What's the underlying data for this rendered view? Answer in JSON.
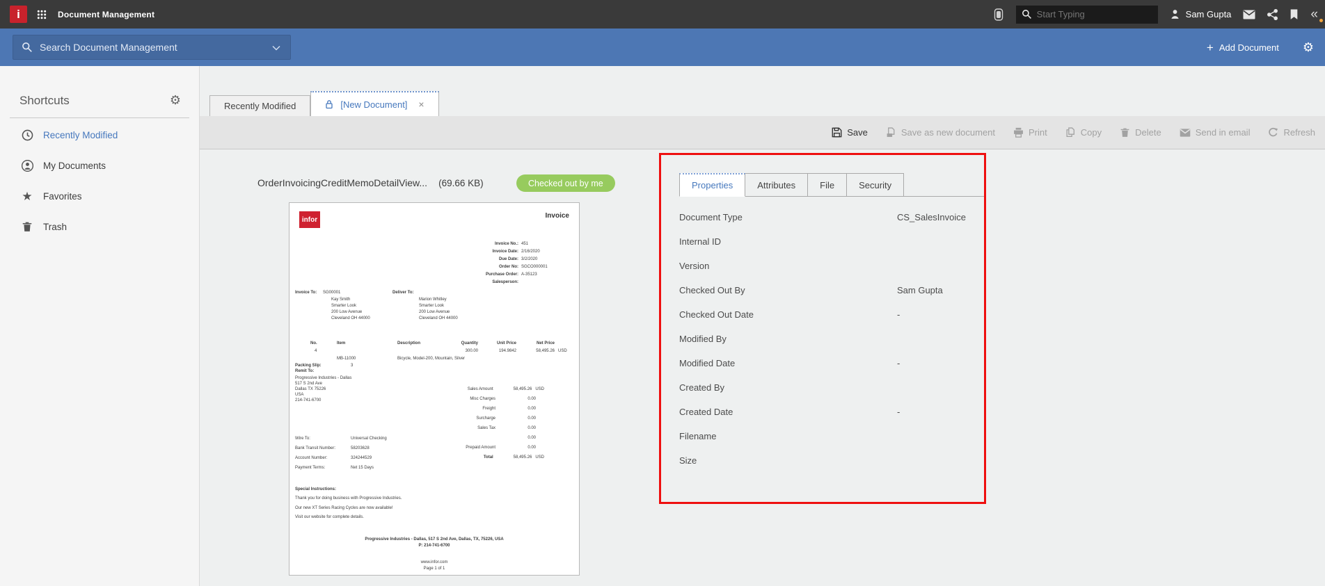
{
  "icons": {
    "gear": "⚙",
    "star": "★",
    "plus": "+",
    "collapse": "«",
    "close": "×"
  },
  "topbar": {
    "app_title": "Document Management",
    "search_placeholder": "Start Typing",
    "user_name": "Sam Gupta"
  },
  "bluebar": {
    "search_label": "Search Document Management",
    "add_document_label": "Add Document"
  },
  "sidebar": {
    "title": "Shortcuts",
    "items": [
      {
        "label": "Recently Modified"
      },
      {
        "label": "My Documents"
      },
      {
        "label": "Favorites"
      },
      {
        "label": "Trash"
      }
    ]
  },
  "tabs": {
    "recently_modified": "Recently Modified",
    "new_document": "[New Document]"
  },
  "toolbar": {
    "save": "Save",
    "save_as_new": "Save as new document",
    "print": "Print",
    "copy": "Copy",
    "delete": "Delete",
    "send_in_email": "Send in email",
    "refresh": "Refresh"
  },
  "document": {
    "name": "OrderInvoicingCreditMemoDetailView...",
    "size": "(69.66 KB)",
    "status_badge": "Checked out by me"
  },
  "panel": {
    "tabs": [
      "Properties",
      "Attributes",
      "File",
      "Security"
    ],
    "fields": [
      {
        "label": "Document Type",
        "value": "CS_SalesInvoice"
      },
      {
        "label": "Internal ID",
        "value": ""
      },
      {
        "label": "Version",
        "value": ""
      },
      {
        "label": "Checked Out By",
        "value": "Sam Gupta"
      },
      {
        "label": "Checked Out Date",
        "value": "-"
      },
      {
        "label": "Modified By",
        "value": ""
      },
      {
        "label": "Modified Date",
        "value": "-"
      },
      {
        "label": "Created By",
        "value": ""
      },
      {
        "label": "Created Date",
        "value": "-"
      },
      {
        "label": "Filename",
        "value": ""
      },
      {
        "label": "Size",
        "value": ""
      }
    ]
  },
  "invoice": {
    "title": "Invoice",
    "logo_text": "infor",
    "meta": [
      {
        "label": "Invoice No.:",
        "value": "451"
      },
      {
        "label": "Invoice Date:",
        "value": "2/16/2020"
      },
      {
        "label": "Due Date:",
        "value": "3/2/2020"
      },
      {
        "label": "Order No:",
        "value": "SGCO000001"
      },
      {
        "label": "Purchase Order:",
        "value": "A-35123"
      },
      {
        "label": "Salesperson:",
        "value": ""
      }
    ],
    "invoice_to_label": "Invoice To:",
    "invoice_to_code": "SG00001",
    "invoice_to_address": [
      "Kay Smith",
      "Smarter Look",
      "200 Low Avenue",
      "Cleveland OH 44000"
    ],
    "deliver_to_label": "Deliver To:",
    "deliver_to_address": [
      "Marion Whitley",
      "Smarter Look",
      "200 Low Avenue",
      "Cleveland OH 44000"
    ],
    "table": {
      "headers": [
        "No.",
        "Item",
        "Description",
        "Quantity",
        "Unit Price",
        "Net Price"
      ],
      "row": {
        "no": "4",
        "item": "MB-11000",
        "description": "Bicycle, Model-200, Mountain, Silver",
        "quantity": "300.00",
        "unit_price": "194.9842",
        "net_price": "58,495.26",
        "currency": "USD"
      }
    },
    "packing_slip_label": "Packing Slip:",
    "packing_slip_value": "3",
    "remit_to_label": "Remit To:",
    "remit_address": [
      "Progressive Industries - Dallas",
      "517 S 2nd Ave",
      "Dallas TX 75226",
      "USA",
      "214-741-6700"
    ],
    "totals": [
      {
        "label": "Sales Amount",
        "value": "58,495.26",
        "currency": "USD"
      },
      {
        "label": "Misc Charges",
        "value": "0.00"
      },
      {
        "label": "Freight",
        "value": "0.00"
      },
      {
        "label": "Surcharge",
        "value": "0.00"
      },
      {
        "label": "Sales Tax",
        "value": "0.00"
      },
      {
        "label": "",
        "value": "0.00"
      },
      {
        "label": "Prepaid Amount",
        "value": "0.00"
      },
      {
        "label": "Total",
        "value": "58,495.26",
        "currency": "USD"
      }
    ],
    "wire": [
      {
        "label": "Wire To:",
        "value": "Universal Checking"
      },
      {
        "label": "Bank Transit Number:",
        "value": "58203628"
      },
      {
        "label": "Account Number:",
        "value": "324244529"
      },
      {
        "label": "Payment Terms:",
        "value": "Net 15 Days"
      }
    ],
    "special_label": "Special Instructions:",
    "special_lines": [
      "Thank you for doing business with Progressive Industries.",
      "Our new XT Series Racing Cycles are now available!",
      "Visit our website for complete details."
    ],
    "footer_line1": "Progressive Industries - Dallas, 517 S 2nd Ave, Dallas, TX, 75226, USA",
    "footer_line2": "P: 214-741-6700",
    "footer_site": "www.infor.com",
    "footer_page": "Page 1 of 1"
  }
}
